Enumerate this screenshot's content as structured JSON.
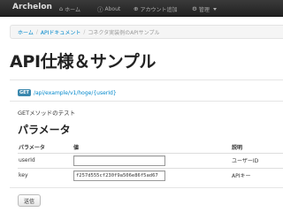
{
  "navbar": {
    "brand": "Archelon",
    "items": [
      {
        "icon": "home-icon",
        "glyph": "⌂",
        "label": "ホーム"
      },
      {
        "icon": "info-icon",
        "glyph": "ⓘ",
        "label": "About"
      },
      {
        "icon": "plus-icon",
        "glyph": "⊕",
        "label": "アカウント追加"
      },
      {
        "icon": "gear-icon",
        "glyph": "⚙",
        "label": "管理"
      }
    ]
  },
  "breadcrumb": {
    "home": "ホーム",
    "separator": "/",
    "docs": "APIドキュメント",
    "current": "コネクタ実装例のAPIサンプル"
  },
  "page": {
    "title": "API仕様＆サンプル"
  },
  "endpoint": {
    "method": "GET",
    "path": "/api/example/v1/hoge/{userId}"
  },
  "description": "GETメソッドのテスト",
  "params": {
    "heading": "パラメータ",
    "headers": [
      "パラメータ",
      "値",
      "説明"
    ],
    "rows": [
      {
        "name": "userId",
        "value": "",
        "desc": "ユーザーID"
      },
      {
        "name": "key",
        "value": "f257d555cf230f9a506e86f5ad67",
        "desc": "APIキー"
      }
    ]
  },
  "form": {
    "submit_label": "送信"
  },
  "colors": {
    "navbar": "#222222",
    "link": "#0088cc",
    "badge": "#3a87ad"
  }
}
